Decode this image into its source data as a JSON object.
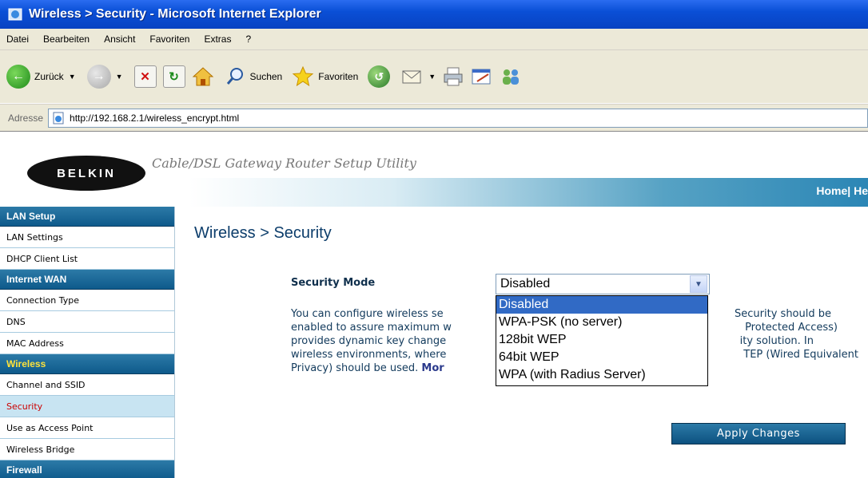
{
  "window": {
    "title": "Wireless > Security - Microsoft Internet Explorer"
  },
  "menu": {
    "items": [
      "Datei",
      "Bearbeiten",
      "Ansicht",
      "Favoriten",
      "Extras",
      "?"
    ]
  },
  "toolbar": {
    "back_label": "Zurück",
    "search_label": "Suchen",
    "favorites_label": "Favoriten"
  },
  "address": {
    "label": "Adresse",
    "url": "http://192.168.2.1/wireless_encrypt.html"
  },
  "header": {
    "logo_text": "BELKIN",
    "utility_title": "Cable/DSL Gateway Router Setup Utility",
    "links": "Home| He"
  },
  "sidebar": {
    "sections": [
      {
        "title": "LAN Setup",
        "items": [
          "LAN Settings",
          "DHCP Client List"
        ]
      },
      {
        "title": "Internet WAN",
        "items": [
          "Connection Type",
          "DNS",
          "MAC Address"
        ]
      },
      {
        "title": "Wireless",
        "items": [
          "Channel and SSID",
          "Security",
          "Use as Access Point",
          "Wireless Bridge"
        ]
      },
      {
        "title": "Firewall",
        "items": []
      }
    ],
    "active_section": "Wireless",
    "active_item": "Security"
  },
  "main": {
    "heading": "Wireless > Security",
    "security_mode_label": "Security Mode",
    "security_mode_value": "Disabled",
    "options": [
      "Disabled",
      "WPA-PSK (no server)",
      "128bit WEP",
      "64bit WEP",
      "WPA (with Radius Server)"
    ],
    "description_lines": [
      "You can configure wireless se",
      "enabled to assure maximum w",
      "provides dynamic key change",
      "wireless environments, where",
      "Privacy) should be used. "
    ],
    "description_right": [
      "Security should be",
      " Protected Access)",
      "ity solution. In",
      "TEP (Wired Equivalent",
      ""
    ],
    "more_text": "Mor",
    "apply_label": "Apply Changes"
  },
  "colors": {
    "accent": "#0e5a8b",
    "active_item": "#cc0000",
    "dropdown_highlight": "#316ac5"
  }
}
